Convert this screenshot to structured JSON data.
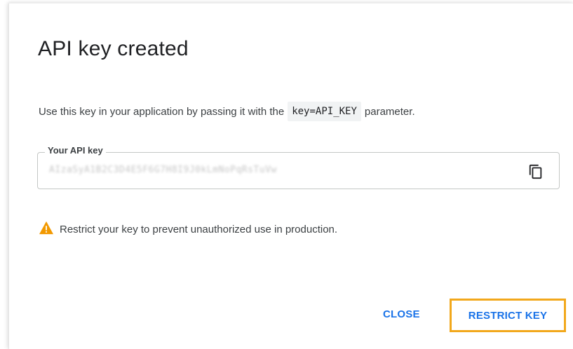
{
  "dialog": {
    "title": "API key created",
    "description_prefix": "Use this key in your application by passing it with the",
    "description_code": "key=API_KEY",
    "description_suffix": "parameter."
  },
  "api_key_field": {
    "label": "Your API key",
    "value": "AIzaSyA1B2C3D4E5F6G7H8I9J0kLmNoPqRsTuVw",
    "copy_icon": "copy-icon"
  },
  "warning": {
    "icon": "warning-icon",
    "text": "Restrict your key to prevent unauthorized use in production.",
    "icon_color": "#f29900"
  },
  "actions": {
    "close_label": "CLOSE",
    "restrict_label": "RESTRICT KEY"
  },
  "colors": {
    "accent": "#1a73e8",
    "highlight_border": "#f2a81c"
  }
}
